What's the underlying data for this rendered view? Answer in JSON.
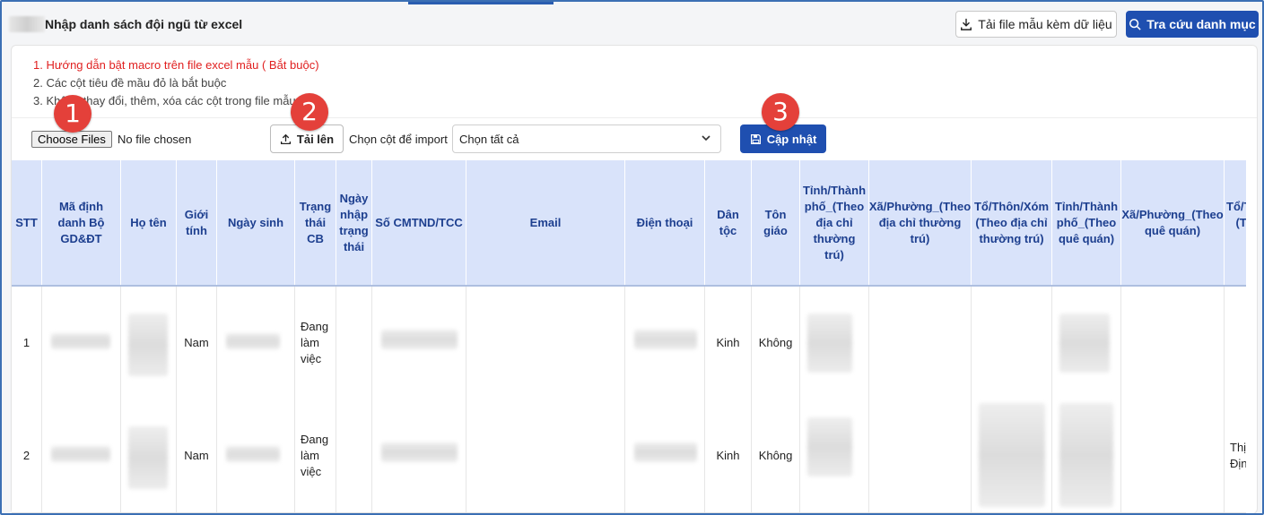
{
  "header": {
    "title": "Nhập danh sách đội ngũ từ excel",
    "download_label": "Tải file mẫu kèm dữ liệu",
    "lookup_label": "Tra cứu danh mục"
  },
  "notes": [
    "1. Hướng dẫn bật macro trên file excel mẫu ( Bắt buộc)",
    "2. Các cột tiêu đề mầu đỏ là bắt buộc",
    "3. Không thay đổi, thêm, xóa các cột trong file mẫu"
  ],
  "toolbar": {
    "choose_files": "Choose Files",
    "no_file": "No file chosen",
    "upload_label": "Tải lên",
    "column_label": "Chọn cột để import",
    "select_value": "Chọn tất cả",
    "update_label": "Cập nhật"
  },
  "steps": [
    "1",
    "2",
    "3"
  ],
  "table": {
    "headers": [
      "STT",
      "Mã định danh Bộ GD&ĐT",
      "Họ tên",
      "Giới tính",
      "Ngày sinh",
      "Trạng thái CB",
      "Ngày nhập trạng thái",
      "Số CMTND/TCC",
      "Email",
      "Điện thoại",
      "Dân tộc",
      "Tôn giáo",
      "Tỉnh/Thành phố_(Theo địa chỉ thường trú)",
      "Xã/Phường_(Theo địa chỉ thường trú)",
      "Tổ/Thôn/Xóm (Theo địa chỉ thường trú)",
      "Tỉnh/Thành phố_(Theo quê quán)",
      "Xã/Phường_(Theo quê quán)",
      "Tổ/Thôn/Xóm (Theo quê quán)"
    ],
    "rows": [
      {
        "stt": "1",
        "gender": "Nam",
        "status": "Đang làm việc",
        "ethnic": "Kinh",
        "religion": "Không",
        "extra": ""
      },
      {
        "stt": "2",
        "gender": "Nam",
        "status": "Đang làm việc",
        "ethnic": "Kinh",
        "religion": "Không",
        "extra": "Thị Định"
      }
    ]
  },
  "colors": {
    "primary": "#1f4fb0",
    "header_bg": "#d9e3fa",
    "header_text": "#1d3f8f",
    "note_red": "#e02020",
    "badge": "#e4403a"
  }
}
